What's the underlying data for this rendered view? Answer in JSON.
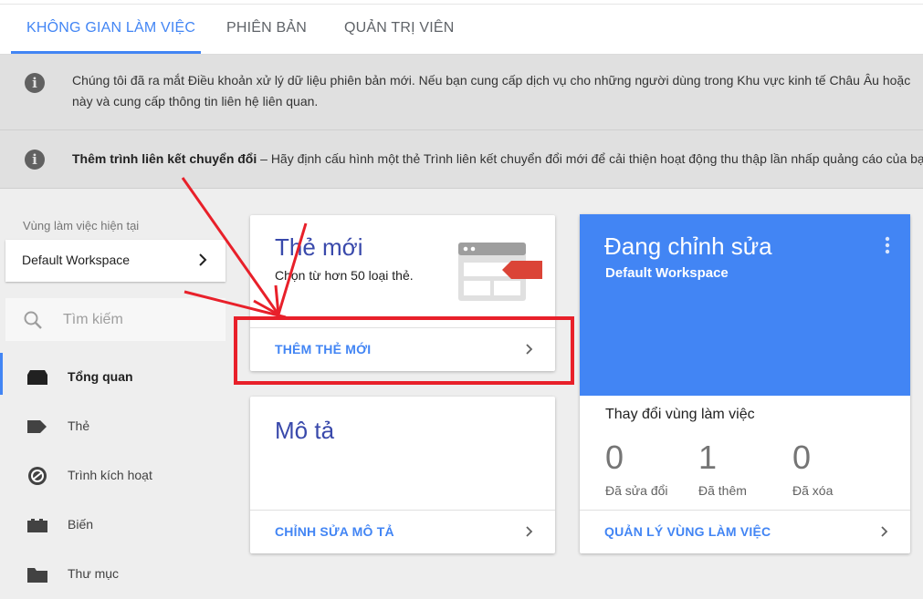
{
  "tabs": [
    {
      "label": "KHÔNG GIAN LÀM VIỆC"
    },
    {
      "label": "PHIÊN BẢN"
    },
    {
      "label": "QUẢN TRỊ VIÊN"
    }
  ],
  "banners": {
    "data_terms": {
      "line1": "Chúng tôi đã ra mắt Điều khoản xử lý dữ liệu phiên bản mới. Nếu bạn cung cấp dịch vụ cho những người dùng trong Khu vực kinh tế Châu Âu hoặc",
      "line2": "này và cung cấp thông tin liên hệ liên quan."
    },
    "conversion_linker": {
      "bold": "Thêm trình liên kết chuyển đổi",
      "text": " – Hãy định cấu hình một thẻ Trình liên kết chuyển đổi mới để cải thiện hoạt động thu thập lần nhấp quảng cáo của bạn."
    }
  },
  "sidebar": {
    "workspace_label": "Vùng làm việc hiện tại",
    "workspace_name": "Default Workspace",
    "search_placeholder": "Tìm kiếm",
    "items": [
      {
        "label": "Tổng quan",
        "icon": "overview-icon"
      },
      {
        "label": "Thẻ",
        "icon": "tag-icon"
      },
      {
        "label": "Trình kích hoạt",
        "icon": "trigger-icon"
      },
      {
        "label": "Biến",
        "icon": "variable-icon"
      },
      {
        "label": "Thư mục",
        "icon": "folder-icon"
      }
    ]
  },
  "new_tag_card": {
    "title": "Thẻ mới",
    "subtitle": "Chọn từ hơn 50 loại thẻ.",
    "action": "THÊM THẺ MỚI"
  },
  "description_card": {
    "title": "Mô tả",
    "action": "CHỈNH SỬA MÔ TẢ"
  },
  "editing_card": {
    "title": "Đang chỉnh sửa",
    "workspace": "Default Workspace",
    "changes_label": "Thay đổi vùng làm việc",
    "stats": [
      {
        "value": "0",
        "label": "Đã sửa đổi"
      },
      {
        "value": "1",
        "label": "Đã thêm"
      },
      {
        "value": "0",
        "label": "Đã xóa"
      }
    ],
    "action": "QUẢN LÝ VÙNG LÀM VIỆC"
  },
  "colors": {
    "accent": "#4285f4",
    "title_blue": "#3949ab",
    "annotation_red": "#e8202a"
  }
}
